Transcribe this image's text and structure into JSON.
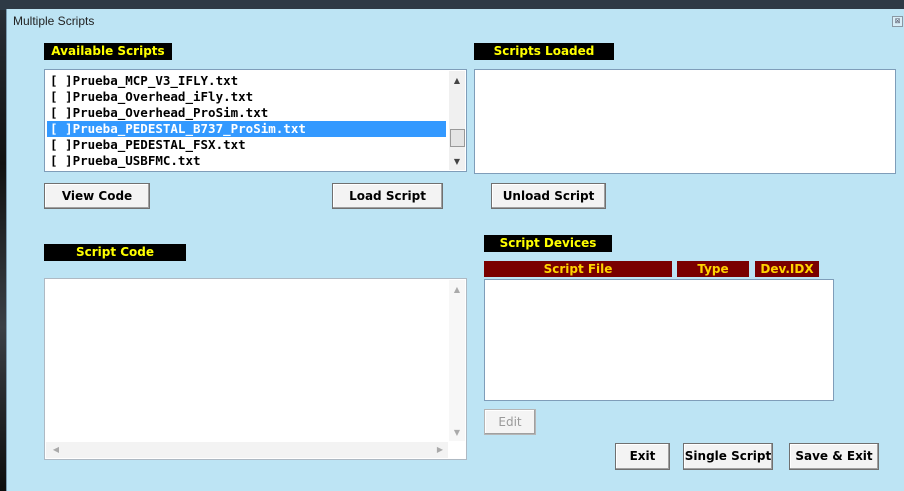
{
  "window": {
    "title": "Multiple Scripts",
    "close_glyph": "⊠"
  },
  "available": {
    "label": "Available Scripts",
    "items": [
      "[  ]Prueba_MCP_V3_IFLY.txt",
      "[  ]Prueba_Overhead_iFly.txt",
      "[  ]Prueba_Overhead_ProSim.txt",
      "[  ]Prueba_PEDESTAL_B737_ProSim.txt",
      "[  ]Prueba_PEDESTAL_FSX.txt",
      "[  ]Prueba_USBFMC.txt"
    ],
    "selected_index": 3
  },
  "loaded": {
    "label": "Scripts Loaded",
    "items": []
  },
  "buttons": {
    "view_code": "View Code",
    "load_script": "Load Script",
    "unload_script": "Unload Script",
    "edit": "Edit",
    "exit": "Exit",
    "single_script": "Single Script",
    "save_exit": "Save & Exit"
  },
  "code": {
    "label": "Script Code",
    "value": ""
  },
  "devices": {
    "label": "Script Devices",
    "columns": [
      "Script File",
      "Type",
      "Dev.IDX"
    ],
    "rows": []
  },
  "colors": {
    "window_bg": "#bde4f4",
    "label_bg": "#000000",
    "label_text": "#ffff00",
    "header_bg": "#7a0000",
    "selection": "#3399ff"
  },
  "icons": {
    "scroll_up": "arrow-up-icon",
    "scroll_down": "arrow-down-icon",
    "scroll_left": "arrow-left-icon",
    "scroll_right": "arrow-right-icon",
    "close": "close-icon"
  }
}
